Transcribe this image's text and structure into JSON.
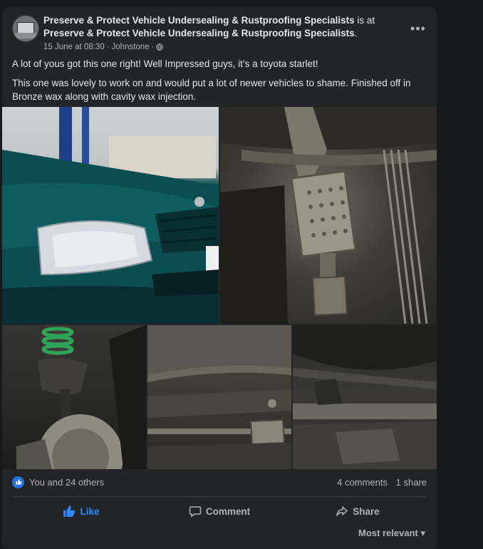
{
  "post": {
    "page_name": "Preserve & Protect Vehicle Undersealing & Rustproofing Specialists",
    "is_at": "is at",
    "location_name": "Preserve & Protect Vehicle Undersealing & Rustproofing Specialists",
    "date": "15 June at 08:30",
    "separator": "·",
    "place": "Johnstone",
    "more_label": "•••",
    "paragraphs": [
      "A lot of yous got this one right! Well Impressed guys, it’s a toyota starlet!",
      "This one was lovely to work on and would put a lot of newer vehicles to shame. Finished off in Bronze wax along with cavity wax injection."
    ]
  },
  "photos": [
    {
      "icon": "car-front-photo"
    },
    {
      "icon": "exhaust-catalytic-converter-photo"
    },
    {
      "icon": "suspension-brake-disc-photo"
    },
    {
      "icon": "underbody-exhaust-pipe-photo"
    },
    {
      "icon": "underbody-rear-photo"
    }
  ],
  "stats": {
    "likers": "You and 24 others",
    "comments": "4 comments",
    "shares": "1 share"
  },
  "actions": {
    "like": "Like",
    "comment": "Comment",
    "share": "Share"
  },
  "comments_sort": "Most relevant",
  "colors": {
    "background": "#18191a",
    "card": "#242526",
    "accent": "#2d88ff",
    "secondary_text": "#b0b3b8"
  }
}
